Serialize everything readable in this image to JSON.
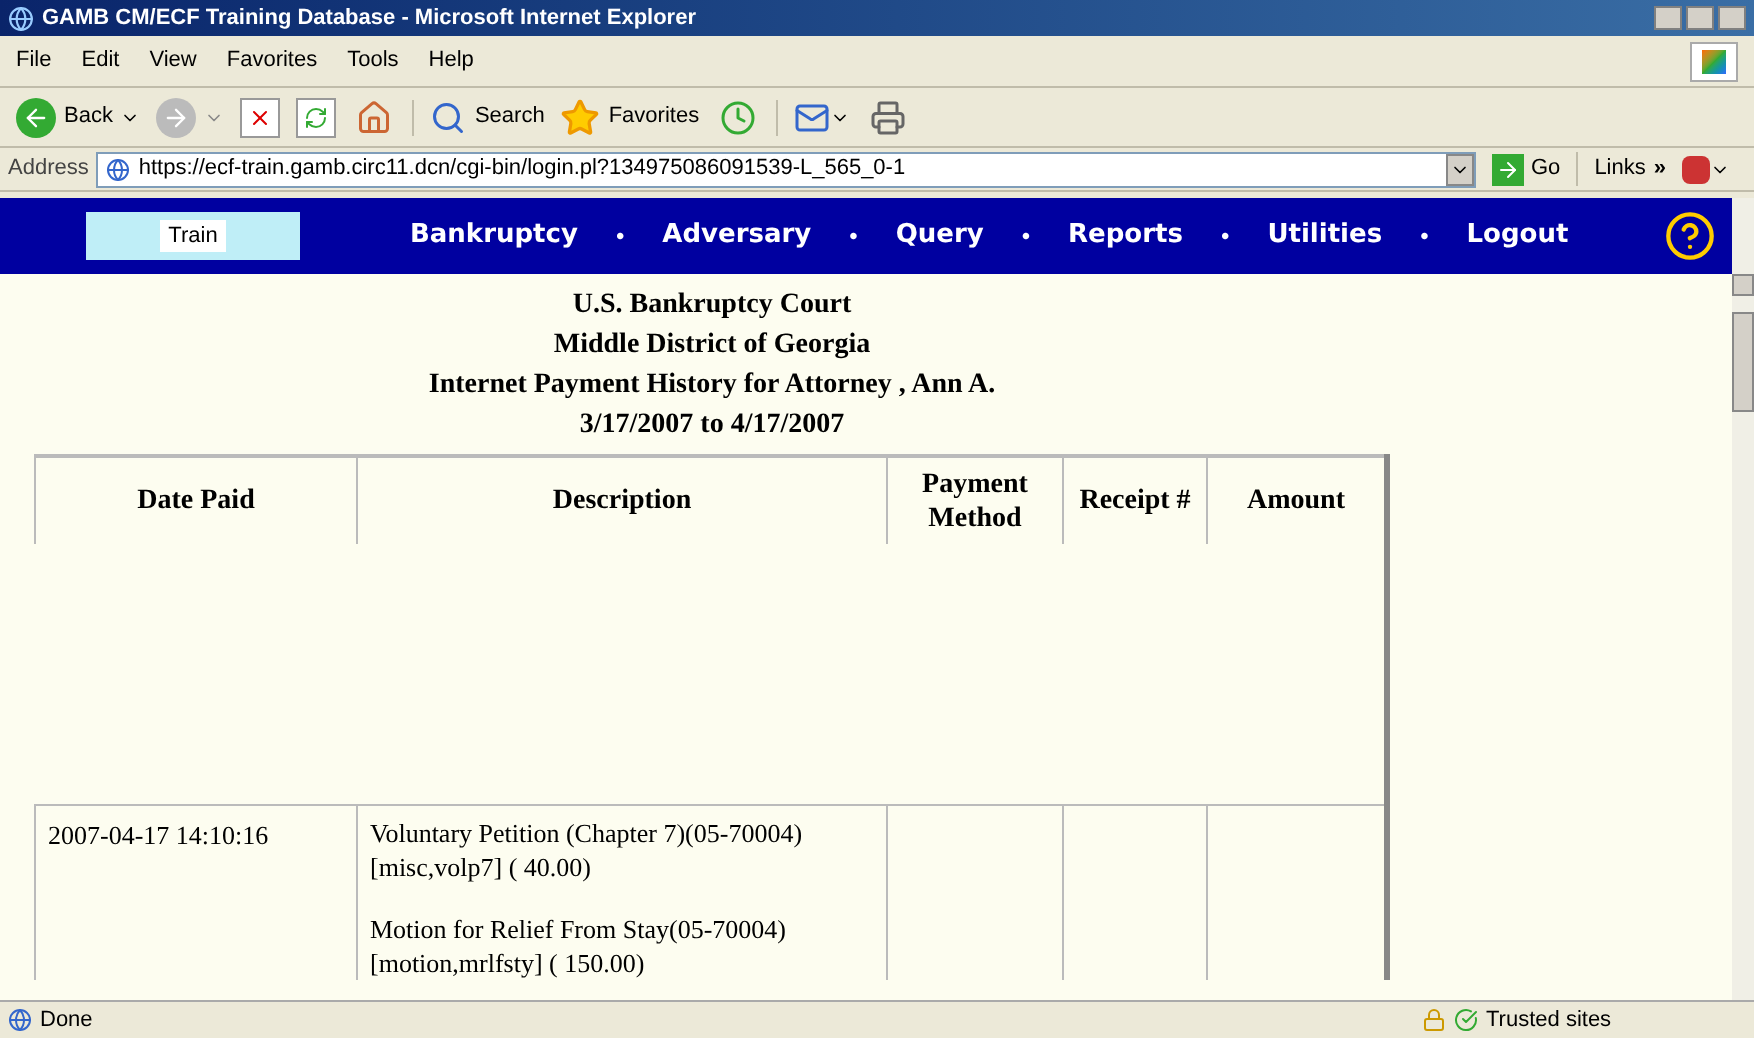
{
  "window": {
    "title": "GAMB CM/ECF Training Database - Microsoft Internet Explorer"
  },
  "menu": [
    "File",
    "Edit",
    "View",
    "Favorites",
    "Tools",
    "Help"
  ],
  "toolbar": {
    "back": "Back",
    "search": "Search",
    "favorites": "Favorites"
  },
  "address": {
    "label": "Address",
    "url": "https://ecf-train.gamb.circ11.dcn/cgi-bin/login.pl?134975086091539-L_565_0-1",
    "go": "Go",
    "links": "Links",
    "chevron": "»"
  },
  "nav": {
    "logo_label": "Train",
    "items": [
      {
        "label": "Bankruptcy",
        "bullet": "•"
      },
      {
        "label": "Adversary",
        "bullet": "•"
      },
      {
        "label": "Query",
        "bullet": "•"
      },
      {
        "label": "Reports",
        "bullet": "•"
      },
      {
        "label": "Utilities",
        "bullet": "•"
      },
      {
        "label": "Logout"
      }
    ]
  },
  "heading": [
    "U.S. Bankruptcy Court",
    "Middle District of Georgia",
    "Internet Payment History for Attorney , Ann A.",
    "3/17/2007 to 4/17/2007"
  ],
  "table": {
    "columns": [
      "Date Paid",
      "Description",
      "Payment Method",
      "Receipt #",
      "Amount"
    ],
    "rows": [
      {
        "date_paid": "2007-04-17 14:10:16",
        "description": [
          "Voluntary Petition (Chapter 7)(05-70004) [misc,volp7] ( 40.00)",
          "Motion for Relief From Stay(05-70004) [motion,mrlfsty] ( 150.00)"
        ]
      }
    ]
  },
  "status_bar": {
    "text": "Done",
    "zone": "Trusted sites"
  }
}
